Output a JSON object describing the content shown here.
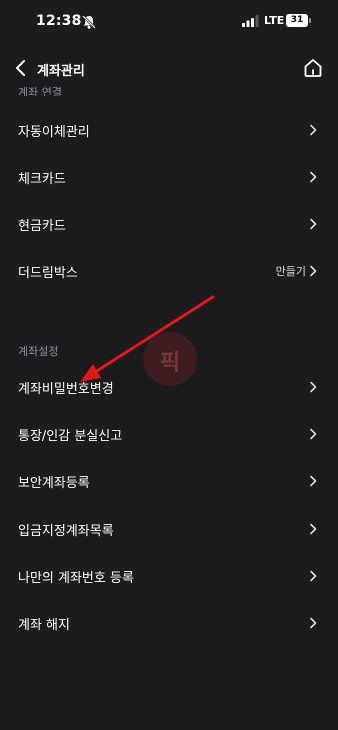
{
  "status_bar": {
    "time": "12:38",
    "network": "LTE",
    "battery": "31"
  },
  "nav": {
    "title": "계좌관리"
  },
  "cut_off_label": "계좌 연결",
  "menu": [
    {
      "label": "자동이체관리"
    },
    {
      "label": "체크카드"
    },
    {
      "label": "현금카드"
    },
    {
      "label": "더드림박스",
      "trailing": "만들기"
    }
  ],
  "settings": {
    "section_label": "계좌설정",
    "items": [
      {
        "label": "계좌비밀번호변경"
      },
      {
        "label": "통장/인감 분실신고"
      },
      {
        "label": "보안계좌등록"
      },
      {
        "label": "입금지정계좌목록"
      },
      {
        "label": "나만의 계좌번호 등록"
      },
      {
        "label": "계좌 해지"
      }
    ]
  },
  "watermark_text": "픽",
  "colors": {
    "background": "#1c1c1e",
    "text": "#ffffff",
    "muted": "#8e8e93",
    "annotation": "#e01818"
  }
}
